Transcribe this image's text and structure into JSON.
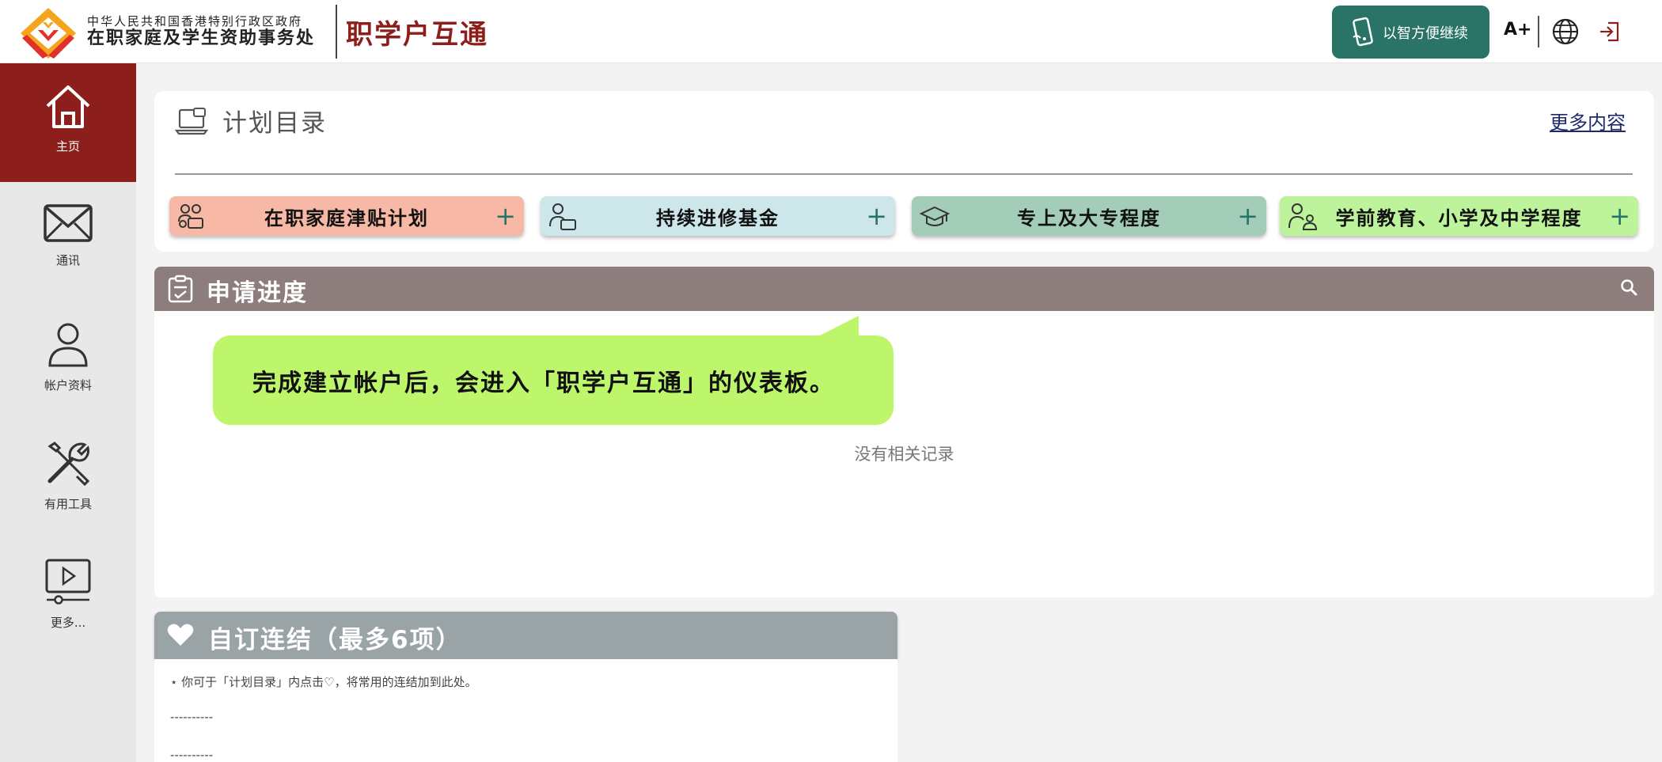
{
  "header": {
    "org_line1": "中华人民共和国香港特别行政区政府",
    "org_line2": "在职家庭及学生资助事务处",
    "brand": "职学户互通",
    "mobile_button": "以智方便继续",
    "font_size_button": "A+",
    "icons": [
      "globe-icon",
      "logout-icon"
    ],
    "colors": {
      "brand": "#8c1f1b",
      "mobile_button": "#2a7467"
    }
  },
  "sidebar": {
    "items": [
      {
        "label": "主页",
        "icon": "home-icon",
        "active": true
      },
      {
        "label": "通讯",
        "icon": "mail-icon",
        "active": false
      },
      {
        "label": "帐户资料",
        "icon": "user-icon",
        "active": false
      },
      {
        "label": "有用工具",
        "icon": "tools-icon",
        "active": false
      },
      {
        "label": "更多...",
        "icon": "video-icon",
        "active": false
      }
    ],
    "active_color": "#8c1f1b"
  },
  "programs": {
    "title": "计划目录",
    "more_link": "更多内容",
    "items": [
      {
        "label": "在职家庭津贴计划",
        "icon": "family-icon",
        "color": "#f7b9a5"
      },
      {
        "label": "持续进修基金",
        "icon": "learner-icon",
        "color": "#cde6ea"
      },
      {
        "label": "专上及大专程度",
        "icon": "graduation-cap-icon",
        "color": "#a4cdb9"
      },
      {
        "label": "学前教育、小学及中学程度",
        "icon": "parent-child-icon",
        "color": "#bdf39a"
      }
    ],
    "plus": "+"
  },
  "application": {
    "title": "申请进度",
    "empty_text": "没有相关记录",
    "bar_color": "#8d7d7d"
  },
  "callout": {
    "text": "完成建立帐户后，会进入「职学户互通」的仪表板。",
    "color": "#bdf66b"
  },
  "favorites": {
    "title": "自订连结（最多6项）",
    "note": "⋆ 你可于「计划目录」内点击♡，将常用的连结加到此处。",
    "placeholders": [
      "----------",
      "----------"
    ],
    "bar_color": "#9aa3a6"
  }
}
